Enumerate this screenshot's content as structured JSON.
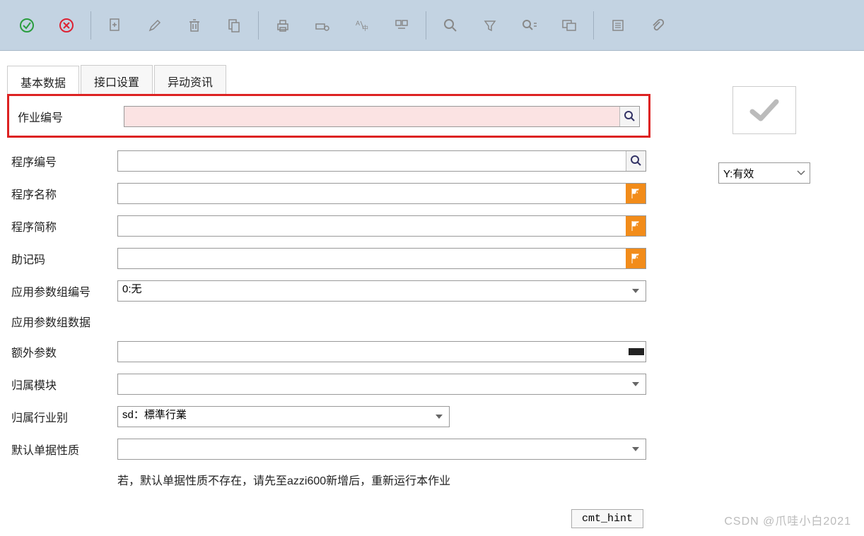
{
  "tabs": {
    "t0": "基本数据",
    "t1": "接口设置",
    "t2": "异动资讯"
  },
  "labels": {
    "job_no": "作业编号",
    "prog_no": "程序编号",
    "prog_name": "程序名称",
    "prog_short": "程序简称",
    "mnemonic": "助记码",
    "param_group_no": "应用参数组编号",
    "param_group_data": "应用参数组数据",
    "extra_param": "额外参数",
    "module": "归属模块",
    "industry": "归属行业别",
    "default_doc": "默认单据性质"
  },
  "values": {
    "job_no": "",
    "prog_no": "",
    "prog_name": "",
    "prog_short": "",
    "mnemonic": "",
    "param_group_no": "0:无",
    "extra_param": "",
    "module": "",
    "industry": "sd：標準行業",
    "default_doc": ""
  },
  "hint": "若，默认单据性质不存在，请先至azzi600新增后，重新运行本作业",
  "cmt_hint": "cmt_hint",
  "status": "Y:有效",
  "watermark": "CSDN @爪哇小白2021"
}
